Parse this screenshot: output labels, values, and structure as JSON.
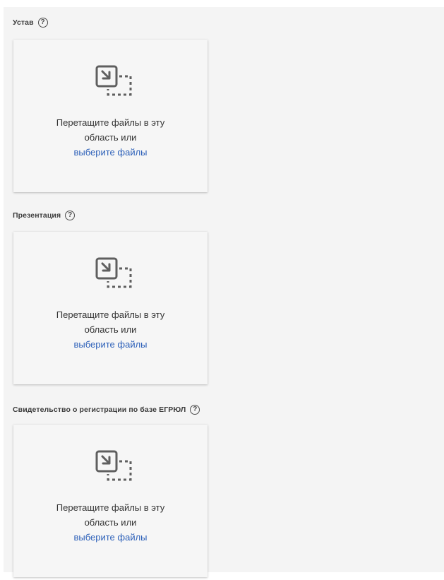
{
  "sections": [
    {
      "label": "Устав",
      "help": "?",
      "dropzone": {
        "line1": "Перетащите файлы в эту",
        "line2": "область или",
        "link": "выберите файлы"
      }
    },
    {
      "label": "Презентация",
      "help": "?",
      "dropzone": {
        "line1": "Перетащите файлы в эту",
        "line2": "область или",
        "link": "выберите файлы"
      }
    },
    {
      "label": "Свидетельство о регистрации по базе ЕГРЮЛ",
      "help": "?",
      "dropzone": {
        "line1": "Перетащите файлы в эту",
        "line2": "область или",
        "link": "выберите файлы"
      }
    }
  ],
  "colors": {
    "link": "#2b5fb8",
    "icon": "#5f5f5f",
    "background": "#f4f4f4"
  },
  "icons": {
    "drop": "file-drop-icon",
    "help": "help-icon"
  }
}
